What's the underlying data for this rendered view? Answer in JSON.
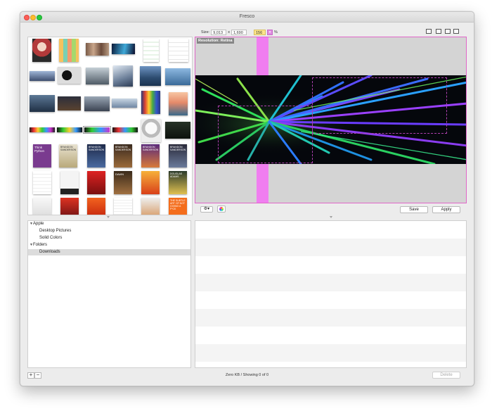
{
  "window": {
    "title": "Fresco"
  },
  "toolbar": {
    "size_label": "Size:",
    "width_value": "9,013",
    "times": "x",
    "height_value": "1,690",
    "zoom_value": "156",
    "percent": "%"
  },
  "preview": {
    "resolution_label": "Resolution: Retina"
  },
  "buttons": {
    "save": "Save",
    "apply": "Apply",
    "delete": "Delete",
    "add": "+",
    "remove": "−",
    "gear": "⚙▾"
  },
  "tree": {
    "groups": [
      {
        "label": "Apple",
        "items": [
          "Desktop Pictures",
          "Solid Colors"
        ]
      },
      {
        "label": "Folders",
        "items": [
          "Downloads"
        ]
      }
    ]
  },
  "status": {
    "text": "Zero KB / Showing 0 of 0"
  },
  "thumbnails": {
    "book_texts": [
      "Think Python",
      "BRANDON SANDERSON",
      "BRANDON SANDERSON",
      "BRANDON SANDERSON",
      "BRANDON SANDERSON",
      "BRANDON SANDERSON",
      "DOUGLAS ADAMS",
      "DAWN",
      "THE SUBTLE ART OF NOT GIVING A F*CK"
    ]
  },
  "colors": {
    "accent_pink": "#f07ef0",
    "preview_border": "#e066c8",
    "zoom_field": "#fce48a"
  }
}
